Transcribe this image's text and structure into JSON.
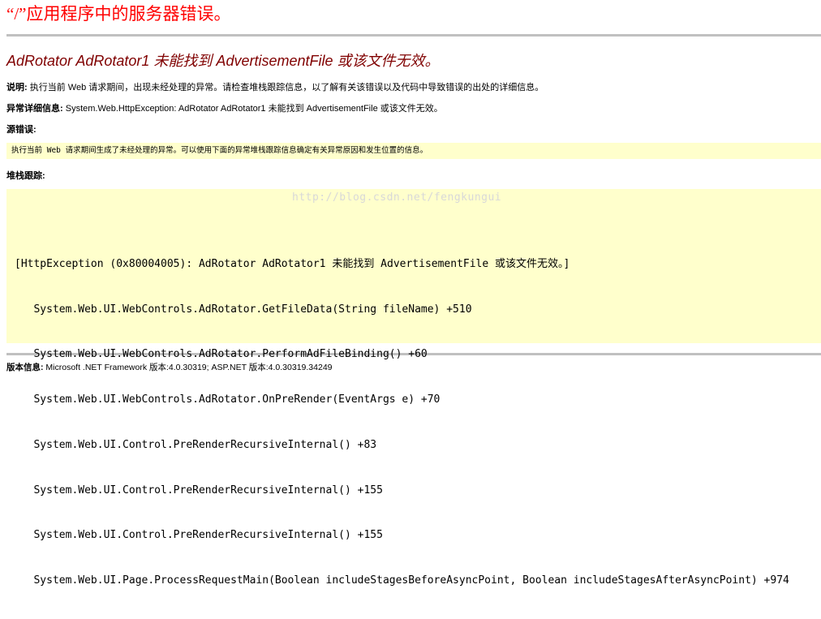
{
  "title": "“/”应用程序中的服务器错误。",
  "heading": "AdRotator AdRotator1 未能找到 AdvertisementFile 或该文件无效。",
  "description": {
    "label": "说明:",
    "text": " 执行当前 Web 请求期间，出现未经处理的异常。请检查堆栈跟踪信息，以了解有关该错误以及代码中导致错误的出处的详细信息。"
  },
  "exception": {
    "label": "异常详细信息:",
    "text": " System.Web.HttpException: AdRotator AdRotator1 未能找到 AdvertisementFile 或该文件无效。"
  },
  "source_error": {
    "label": "源错误:",
    "box_text": "执行当前 Web 请求期间生成了未经处理的异常。可以使用下面的异常堆栈跟踪信息确定有关异常原因和发生位置的信息。"
  },
  "stack_trace": {
    "label": "堆栈跟踪:",
    "watermark": "http://blog.csdn.net/fengkungui",
    "lines": [
      "[HttpException (0x80004005): AdRotator AdRotator1 未能找到 AdvertisementFile 或该文件无效。]",
      "   System.Web.UI.WebControls.AdRotator.GetFileData(String fileName) +510",
      "   System.Web.UI.WebControls.AdRotator.PerformAdFileBinding() +60",
      "   System.Web.UI.WebControls.AdRotator.OnPreRender(EventArgs e) +70",
      "   System.Web.UI.Control.PreRenderRecursiveInternal() +83",
      "   System.Web.UI.Control.PreRenderRecursiveInternal() +155",
      "   System.Web.UI.Control.PreRenderRecursiveInternal() +155",
      "   System.Web.UI.Page.ProcessRequestMain(Boolean includeStagesBeforeAsyncPoint, Boolean includeStagesAfterAsyncPoint) +974"
    ]
  },
  "version": {
    "label": "版本信息:",
    "text": " Microsoft .NET Framework 版本:4.0.30319; ASP.NET 版本:4.0.30319.34249"
  },
  "colors": {
    "title": "#ff0000",
    "heading": "#800000",
    "code_background": "#ffffcc",
    "rule": "#c0c0c0"
  }
}
